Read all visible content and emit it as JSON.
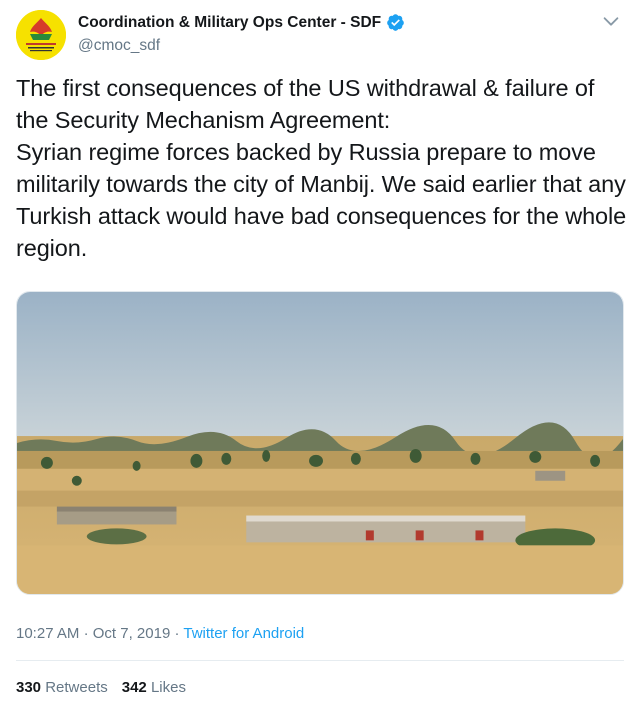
{
  "account": {
    "display_name": "Coordination & Military Ops Center - SDF",
    "handle": "@cmoc_sdf",
    "verified": true,
    "avatar_icon": "sdf-logo-icon",
    "avatar_color": "#f6e100"
  },
  "tweet": {
    "lines": [
      "The first consequences of the US withdrawal & failure of the Security Mechanism Agreement:",
      "Syrian regime forces backed by Russia prepare to move militarily towards the city of Manbij. We said earlier that any Turkish attack would have bad consequences for the whole region."
    ]
  },
  "media": {
    "icon": "landscape-photo"
  },
  "meta": {
    "time": "10:27 AM",
    "separator1": "·",
    "date": "Oct 7, 2019",
    "separator2": "·",
    "source": "Twitter for Android"
  },
  "stats": {
    "retweets_count": "330",
    "retweets_label": "Retweets",
    "likes_count": "342",
    "likes_label": "Likes"
  },
  "colors": {
    "link": "#1da1f2",
    "secondary_text": "#657786",
    "primary_text": "#14171a",
    "verified_badge": "#1da1f2"
  }
}
